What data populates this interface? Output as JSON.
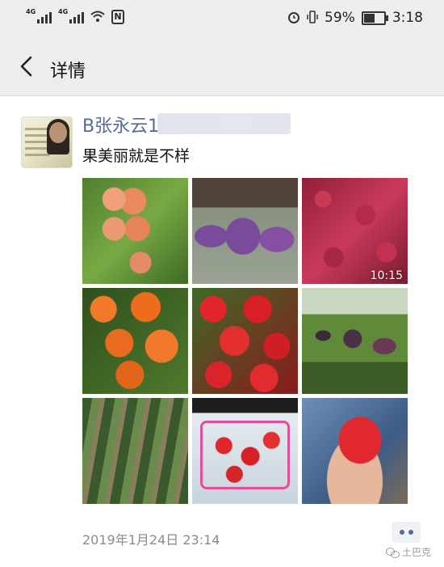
{
  "status_bar": {
    "signal1_label": "4G",
    "signal2_label": "4G",
    "battery_percent": "59%",
    "battery_level": 0.59,
    "time": "3:18",
    "icons": [
      "signal-icon",
      "signal-icon",
      "wifi-icon",
      "nfc-icon",
      "alarm-icon",
      "vibrate-icon",
      "battery-icon"
    ]
  },
  "nav": {
    "back_icon": "chevron-left-icon",
    "title": "详情"
  },
  "post": {
    "username": "B张永云1",
    "text": "果美丽就是不样",
    "images": [
      {
        "desc": "peaches-on-tree",
        "overlay": ""
      },
      {
        "desc": "purple-buckets",
        "overlay": ""
      },
      {
        "desc": "red-fruit-pile",
        "overlay": "10:15"
      },
      {
        "desc": "oranges",
        "overlay": ""
      },
      {
        "desc": "strawberries",
        "overlay": ""
      },
      {
        "desc": "grapes-vineyard",
        "overlay": ""
      },
      {
        "desc": "strawberry-field",
        "overlay": ""
      },
      {
        "desc": "strawberry-basket",
        "overlay": ""
      },
      {
        "desc": "big-strawberry-in-hand",
        "overlay": ""
      }
    ],
    "timestamp": "2019年1月24日 23:14"
  },
  "watermark": {
    "text": "土巴克",
    "icon": "wechat-icon"
  },
  "colors": {
    "link": "#576b95",
    "bar_bg": "#ededed",
    "time_gray": "#8a8a8a"
  }
}
